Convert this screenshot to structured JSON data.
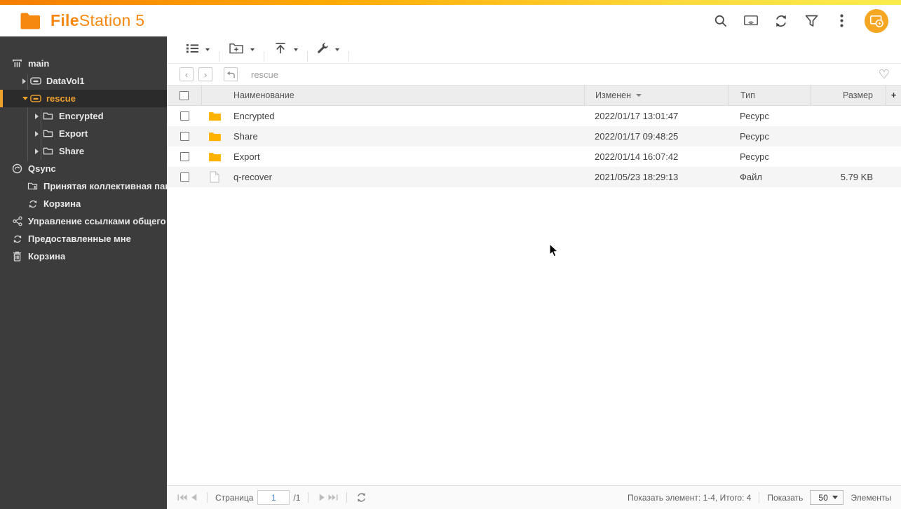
{
  "colors": {
    "accent_orange": "#F6870F",
    "selected_orange": "#EFA12D",
    "folder_amber": "#FFB300",
    "sidebar_bg": "#3C3C3C",
    "gradient_left": "#F57D00",
    "gradient_right": "#FBEC4E"
  },
  "header": {
    "app_title_bold": "File",
    "app_title_rest": "Station 5"
  },
  "breadcrumb": {
    "path": "rescue"
  },
  "sidebar": {
    "items": [
      {
        "label": "main"
      },
      {
        "label": "DataVol1"
      },
      {
        "label": "rescue"
      },
      {
        "label": "Encrypted"
      },
      {
        "label": "Export"
      },
      {
        "label": "Share"
      },
      {
        "label": "Qsync"
      },
      {
        "label": "Принятая коллективная папка"
      },
      {
        "label": "Корзина"
      },
      {
        "label": "Управление ссылками общего доступа"
      },
      {
        "label": "Предоставленные мне"
      },
      {
        "label": "Корзина"
      }
    ]
  },
  "table": {
    "columns": {
      "name": "Наименование",
      "modified": "Изменен",
      "type": "Тип",
      "size": "Размер",
      "add": "+"
    },
    "sort": {
      "column": "Изменен",
      "direction": "desc"
    },
    "rows": [
      {
        "icon": "folder",
        "name": "Encrypted",
        "modified": "2022/01/17 13:01:47",
        "type": "Ресурс",
        "size": ""
      },
      {
        "icon": "folder",
        "name": "Share",
        "modified": "2022/01/17 09:48:25",
        "type": "Ресурс",
        "size": ""
      },
      {
        "icon": "folder",
        "name": "Export",
        "modified": "2022/01/14 16:07:42",
        "type": "Ресурс",
        "size": ""
      },
      {
        "icon": "file",
        "name": "q-recover",
        "modified": "2021/05/23 18:29:13",
        "type": "Файл",
        "size": "5.79 KB"
      }
    ]
  },
  "footer": {
    "page_label": "Страница",
    "page_value": "1",
    "page_total": "/1",
    "items_info": "Показать элемент: 1-4, Итого: 4",
    "show_label": "Показать",
    "page_size": "50",
    "items_label": "Элементы"
  }
}
